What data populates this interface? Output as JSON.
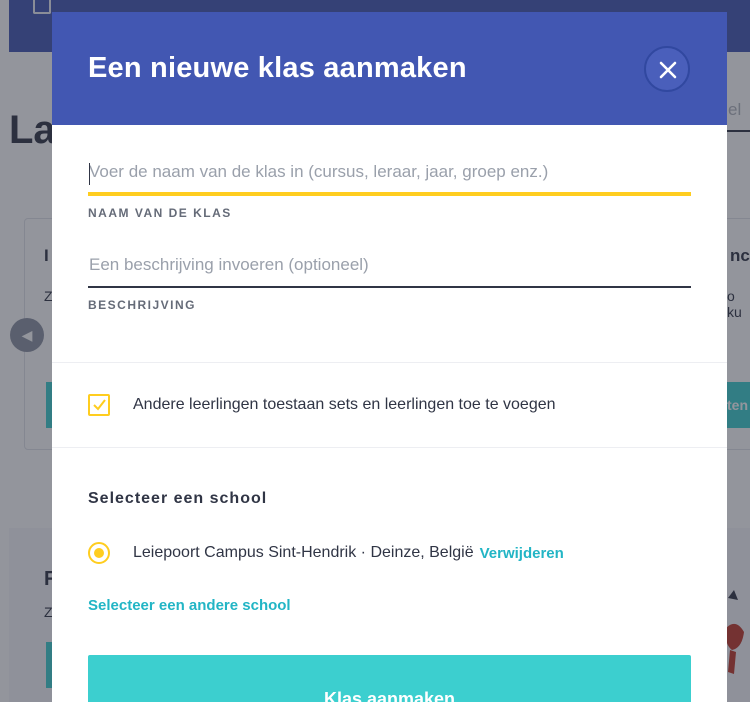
{
  "background": {
    "heading_fragment": "La",
    "search_fragment": "el",
    "right_card_title_fragment": "nc",
    "right_card_text_fragment": "o ku",
    "right_button_fragment": "ten",
    "left_card_title_fragment": "I",
    "left_card_text_fragment": "Z",
    "lower_card_title_fragment": "F",
    "lower_card_text_fragment": "Z"
  },
  "modal": {
    "title": "Een nieuwe klas aanmaken",
    "close_icon": "close-icon",
    "class_name": {
      "value": "",
      "placeholder": "Voer de naam van de klas in (cursus, leraar, jaar, groep enz.)",
      "label": "NAAM VAN DE KLAS"
    },
    "description": {
      "value": "",
      "placeholder": "Een beschrijving invoeren (optioneel)",
      "label": "BESCHRIJVING"
    },
    "allow_others": {
      "checked": true,
      "label": "Andere leerlingen toestaan sets en leerlingen toe te voegen"
    },
    "school_section": {
      "title": "Selecteer een school",
      "selected_school": "Leiepoort Campus Sint-Hendrik · Deinze, België",
      "remove_label": "Verwijderen",
      "other_school_label": "Selecteer een andere school"
    },
    "submit_label": "Klas aanmaken"
  },
  "colors": {
    "header": "#4257b2",
    "accent_yellow": "#ffcd1f",
    "teal": "#3ccfcf",
    "link": "#22b5c5",
    "text": "#303545"
  }
}
